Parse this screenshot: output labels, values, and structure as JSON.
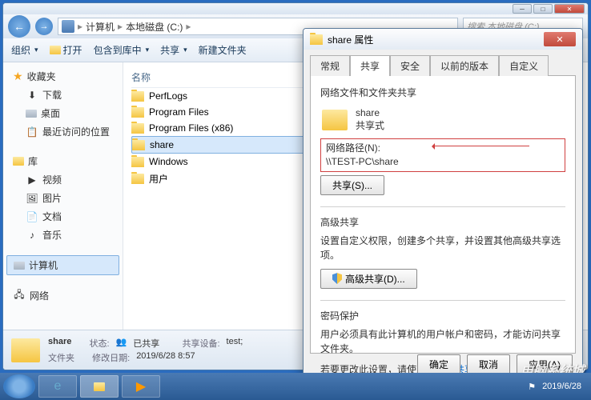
{
  "window": {
    "breadcrumb": {
      "computer": "计算机",
      "drive": "本地磁盘 (C:)"
    },
    "search_placeholder": "搜索 本地磁盘 (C:)"
  },
  "toolbar": {
    "organize": "组织",
    "open": "打开",
    "include": "包含到库中",
    "share": "共享",
    "newfolder": "新建文件夹"
  },
  "sidebar": {
    "favorites": "收藏夹",
    "fav_items": [
      "下载",
      "桌面",
      "最近访问的位置"
    ],
    "libraries": "库",
    "lib_items": [
      "视频",
      "图片",
      "文档",
      "音乐"
    ],
    "computer": "计算机",
    "network": "网络"
  },
  "content": {
    "col_name": "名称",
    "items": [
      "PerfLogs",
      "Program Files",
      "Program Files (x86)",
      "share",
      "Windows",
      "用户"
    ]
  },
  "statusbar": {
    "name": "share",
    "type": "文件夹",
    "status_lbl": "状态:",
    "status_val": "已共享",
    "modified_lbl": "修改日期:",
    "modified_val": "2019/6/28 8:57",
    "sharedev_lbl": "共享设备:",
    "sharedev_val": "test;"
  },
  "dialog": {
    "title": "share 属性",
    "tabs": {
      "general": "常规",
      "sharing": "共享",
      "security": "安全",
      "previous": "以前的版本",
      "custom": "自定义"
    },
    "section1_title": "网络文件和文件夹共享",
    "share_name": "share",
    "share_mode": "共享式",
    "path_label": "网络路径(N):",
    "path_value": "\\\\TEST-PC\\share",
    "share_btn": "共享(S)...",
    "section2_title": "高级共享",
    "section2_note": "设置自定义权限，创建多个共享，并设置其他高级共享选项。",
    "adv_btn": "高级共享(D)...",
    "section3_title": "密码保护",
    "section3_note": "用户必须具有此计算机的用户帐户和密码，才能访问共享文件夹。",
    "section3_note2a": "若要更改此设置，请使用",
    "section3_link": "网络和共享中心",
    "ok": "确定",
    "cancel": "取消",
    "apply": "应用(A)"
  },
  "taskbar": {
    "time": "2019/6/28"
  },
  "watermark": "电脑系统城"
}
